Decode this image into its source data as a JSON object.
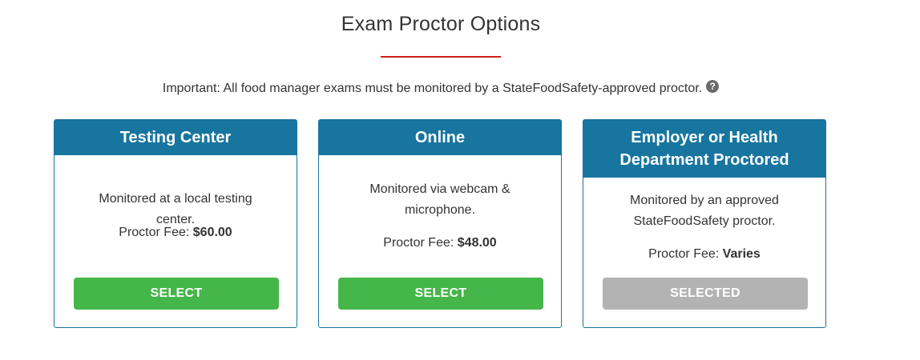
{
  "header": {
    "title": "Exam Proctor Options",
    "notice": "Important: All food manager exams must be monitored by a StateFoodSafety-approved proctor.",
    "help_glyph": "?"
  },
  "colors": {
    "accent_red": "#d0201c",
    "header_blue": "#1775a0",
    "select_green": "#45b649",
    "selected_gray": "#b3b3b3"
  },
  "fee_label": "Proctor Fee:",
  "cards": [
    {
      "title": "Testing Center",
      "description": "Monitored at a local testing center.",
      "fee": "$60.00",
      "button": "SELECT",
      "selected": false
    },
    {
      "title": "Online",
      "description": "Monitored via webcam & microphone.",
      "fee": "$48.00",
      "button": "SELECT",
      "selected": false
    },
    {
      "title": "Employer or Health Department Proctored",
      "description": "Monitored by an approved StateFoodSafety proctor.",
      "fee": "Varies",
      "button": "SELECTED",
      "selected": true
    }
  ]
}
